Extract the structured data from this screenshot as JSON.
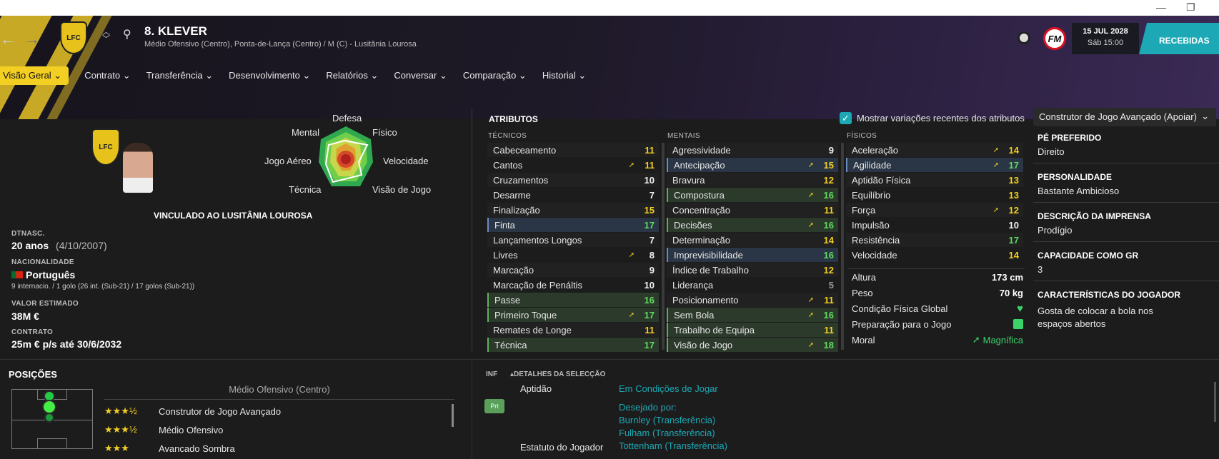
{
  "header": {
    "player_name": "8. KLEVER",
    "player_sub": "Médio Ofensivo (Centro), Ponta-de-Lança (Centro) / M (C) - Lusitânia Lourosa",
    "club_badge": "LFC",
    "date": "15 JUL 2028",
    "time": "Sáb 15:00",
    "inbox_label": "RECEBIDAS",
    "logo_text": "FM"
  },
  "menu": [
    {
      "label": "Visão Geral",
      "active": true
    },
    {
      "label": "Contrato"
    },
    {
      "label": "Transferência"
    },
    {
      "label": "Desenvolvimento"
    },
    {
      "label": "Relatórios"
    },
    {
      "label": "Conversar"
    },
    {
      "label": "Comparação"
    },
    {
      "label": "Historial"
    }
  ],
  "radar": {
    "labels": [
      "Defesa",
      "Mental",
      "Físico",
      "Jogo Aéreo",
      "Velocidade",
      "Técnica",
      "Visão de Jogo"
    ],
    "colors": [
      "#2fa84f",
      "#6fcf4a",
      "#c7d64a",
      "#e0a030",
      "#d24a2a",
      "#b01e1e"
    ]
  },
  "profile": {
    "contract_banner": "VINCULADO AO LUSITÂNIA LOUROSA",
    "dob_label": "DTNASC.",
    "age": "20 anos",
    "dob": "(4/10/2007)",
    "nationality_label": "NACIONALIDADE",
    "nationality": "Português",
    "caps": "9 internacio. / 1 golo (26 int. (Sub-21) / 17 golos (Sub-21))",
    "value_label": "VALOR ESTIMADO",
    "value": "38M €",
    "contract_label": "CONTRATO",
    "contract": "25m € p/s até 30/6/2032"
  },
  "attributes": {
    "title": "ATRIBUTOS",
    "show_changes_label": "Mostrar variações recentes dos atributos",
    "role_select": "Construtor de Jogo Avançado (Apoiar)",
    "technical_header": "TÉCNICOS",
    "mental_header": "MENTAIS",
    "physical_header": "FÍSICOS",
    "technical": [
      {
        "name": "Cabeceamento",
        "value": "11",
        "c": "v-y"
      },
      {
        "name": "Cantos",
        "value": "11",
        "c": "v-y",
        "arrow": true
      },
      {
        "name": "Cruzamentos",
        "value": "10",
        "c": "v-w"
      },
      {
        "name": "Desarme",
        "value": "7",
        "c": "v-w"
      },
      {
        "name": "Finalização",
        "value": "15",
        "c": "v-y"
      },
      {
        "name": "Finta",
        "value": "17",
        "c": "v-g",
        "hl": "hl-blue"
      },
      {
        "name": "Lançamentos Longos",
        "value": "7",
        "c": "v-w"
      },
      {
        "name": "Livres",
        "value": "8",
        "c": "v-w",
        "arrow": true
      },
      {
        "name": "Marcação",
        "value": "9",
        "c": "v-w"
      },
      {
        "name": "Marcação de Penáltis",
        "value": "10",
        "c": "v-w"
      },
      {
        "name": "Passe",
        "value": "16",
        "c": "v-g",
        "hl": "hl-green"
      },
      {
        "name": "Primeiro Toque",
        "value": "17",
        "c": "v-g",
        "hl": "hl-green",
        "arrow": true
      },
      {
        "name": "Remates de Longe",
        "value": "11",
        "c": "v-y"
      },
      {
        "name": "Técnica",
        "value": "17",
        "c": "v-g",
        "hl": "hl-green"
      }
    ],
    "mental": [
      {
        "name": "Agressividade",
        "value": "9",
        "c": "v-w"
      },
      {
        "name": "Antecipação",
        "value": "15",
        "c": "v-y",
        "hl": "hl-blue",
        "arrow": true
      },
      {
        "name": "Bravura",
        "value": "12",
        "c": "v-y"
      },
      {
        "name": "Compostura",
        "value": "16",
        "c": "v-g",
        "hl": "hl-green",
        "arrow": true
      },
      {
        "name": "Concentração",
        "value": "11",
        "c": "v-y"
      },
      {
        "name": "Decisões",
        "value": "16",
        "c": "v-g",
        "hl": "hl-green",
        "arrow": true
      },
      {
        "name": "Determinação",
        "value": "14",
        "c": "v-y"
      },
      {
        "name": "Imprevisibilidade",
        "value": "16",
        "c": "v-g",
        "hl": "hl-blue"
      },
      {
        "name": "Índice de Trabalho",
        "value": "12",
        "c": "v-y"
      },
      {
        "name": "Liderança",
        "value": "5",
        "c": "v-gr"
      },
      {
        "name": "Posicionamento",
        "value": "11",
        "c": "v-y",
        "arrow": true
      },
      {
        "name": "Sem Bola",
        "value": "16",
        "c": "v-g",
        "hl": "hl-green",
        "arrow": true
      },
      {
        "name": "Trabalho de Equipa",
        "value": "11",
        "c": "v-y",
        "hl": "hl-green"
      },
      {
        "name": "Visão de Jogo",
        "value": "18",
        "c": "v-g",
        "hl": "hl-green",
        "arrow": true
      }
    ],
    "physical": [
      {
        "name": "Aceleração",
        "value": "14",
        "c": "v-y",
        "arrow": true
      },
      {
        "name": "Agilidade",
        "value": "17",
        "c": "v-g",
        "hl": "hl-blue",
        "arrow": true
      },
      {
        "name": "Aptidão Física",
        "value": "13",
        "c": "v-y"
      },
      {
        "name": "Equilíbrio",
        "value": "13",
        "c": "v-y"
      },
      {
        "name": "Força",
        "value": "12",
        "c": "v-y",
        "arrow": true
      },
      {
        "name": "Impulsão",
        "value": "10",
        "c": "v-w"
      },
      {
        "name": "Resistência",
        "value": "17",
        "c": "v-g"
      },
      {
        "name": "Velocidade",
        "value": "14",
        "c": "v-y"
      }
    ],
    "height_label": "Altura",
    "height": "173 cm",
    "weight_label": "Peso",
    "weight": "70 kg",
    "condition_label": "Condição Física Global",
    "match_prep_label": "Preparação para o Jogo",
    "morale_label": "Moral",
    "morale": "Magnífica"
  },
  "right_panel": {
    "foot_label": "PÉ PREFERIDO",
    "foot": "Direito",
    "personality_label": "PERSONALIDADE",
    "personality": "Bastante Ambicioso",
    "media_label": "DESCRIÇÃO DA IMPRENSA",
    "media": "Prodígio",
    "gk_label": "CAPACIDADE COMO GR",
    "gk": "3",
    "traits_label": "CARACTERÍSTICAS DO JOGADOR",
    "traits": "Gosta de colocar a bola nos espaços abertos"
  },
  "positions": {
    "title": "POSIÇÕES",
    "main": "Médio Ofensivo (Centro)",
    "roles": [
      {
        "stars": "★★★½",
        "name": "Construtor de Jogo Avançado"
      },
      {
        "stars": "★★★½",
        "name": "Médio Ofensivo"
      },
      {
        "stars": "★★★",
        "name": "Avancado Sombra"
      }
    ]
  },
  "selection": {
    "inf_label": "INF",
    "details_label": "DETALHES DA SELECÇÃO",
    "badge": "Prt",
    "fitness_label": "Aptidão",
    "fitness_value": "Em Condições de Jogar",
    "wanted_label": "Desejado por:",
    "wanted": [
      "Burnley (Transferência)",
      "Fulham (Transferência)",
      "Tottenham (Transferência)"
    ],
    "status_label": "Estatuto do Jogador"
  }
}
